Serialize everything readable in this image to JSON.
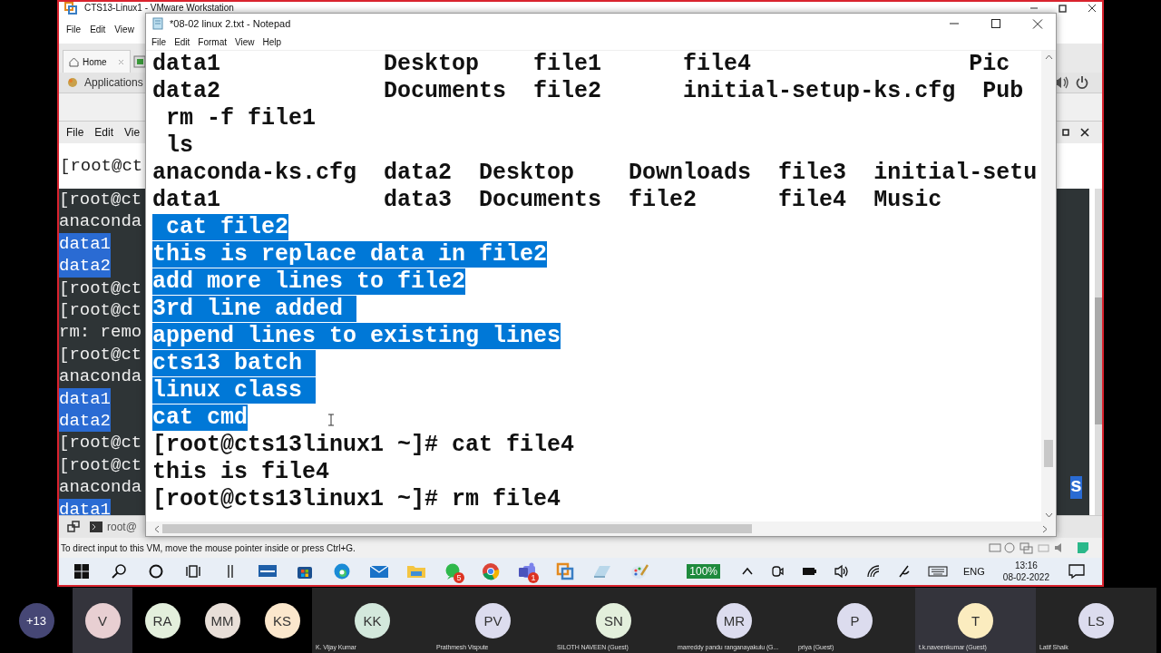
{
  "vmware": {
    "title": "CTS13-Linux1 - VMware Workstation",
    "menu": [
      "File",
      "Edit",
      "View"
    ],
    "tabs": [
      {
        "label": "Home",
        "selected": false
      }
    ],
    "gnome_menu": "Applications",
    "guest_menu": [
      "File",
      "Edit",
      "Vie"
    ],
    "prompt_line": "[root@ct",
    "terminal_lines": [
      {
        "text": "[root@ct",
        "selected": false
      },
      {
        "text": "anaconda",
        "selected": false
      },
      {
        "text": "data1",
        "selected": true
      },
      {
        "text": "data2",
        "selected": true
      },
      {
        "text": "[root@ct",
        "selected": false
      },
      {
        "text": "[root@ct",
        "selected": false
      },
      {
        "text": "rm: remo",
        "selected": false
      },
      {
        "text": "[root@ct",
        "selected": false
      },
      {
        "text": "anaconda",
        "selected": false
      },
      {
        "text": "data1",
        "selected": true
      },
      {
        "text": "data2",
        "selected": true
      },
      {
        "text": "[root@ct",
        "selected": false
      },
      {
        "text": "[root@ct",
        "selected": false
      },
      {
        "text": "anaconda",
        "selected": false,
        "right": {
          "text": "s",
          "selected": true
        }
      },
      {
        "text": "data1",
        "selected": true
      }
    ],
    "bottom_tab": "root@",
    "status": "To direct input to this VM, move the mouse pointer inside or press Ctrl+G."
  },
  "notepad": {
    "title": "*08-02 linux 2.txt - Notepad",
    "menu": [
      "File",
      "Edit",
      "Format",
      "View",
      "Help"
    ],
    "lines": [
      {
        "text": "data1            Desktop    file1      file4                Pic",
        "selected": false
      },
      {
        "text": "data2            Documents  file2      initial-setup-ks.cfg  Pub",
        "selected": false
      },
      {
        "text": " rm -f file1",
        "selected": false
      },
      {
        "text": " ls",
        "selected": false
      },
      {
        "text": "anaconda-ks.cfg  data2  Desktop    Downloads  file3  initial-setu",
        "selected": false
      },
      {
        "text": "data1            data3  Documents  file2      file4  Music",
        "selected": false
      },
      {
        "text": " cat file2",
        "selected": true
      },
      {
        "text": "this is replace data in file2",
        "selected": true
      },
      {
        "text": "add more lines to file2",
        "selected": true
      },
      {
        "text": "3rd line added ",
        "selected": true
      },
      {
        "text": "append lines to existing lines",
        "selected": true
      },
      {
        "text": "cts13 batch ",
        "selected": true
      },
      {
        "text": "linux class ",
        "selected": true
      },
      {
        "text": "cat cmd",
        "selected": true
      },
      {
        "text": "[root@cts13linux1 ~]# cat file4",
        "selected": false
      },
      {
        "text": "this is file4",
        "selected": false
      },
      {
        "text": "[root@cts13linux1 ~]# rm file4",
        "selected": false
      }
    ]
  },
  "taskbar": {
    "items": [
      {
        "kind": "start"
      },
      {
        "kind": "search"
      },
      {
        "kind": "cortana"
      },
      {
        "kind": "taskview"
      },
      {
        "kind": "bars"
      },
      {
        "kind": "monitor"
      },
      {
        "kind": "store"
      },
      {
        "kind": "edge"
      },
      {
        "kind": "mail"
      },
      {
        "kind": "folder"
      },
      {
        "kind": "chat",
        "badge": "5"
      },
      {
        "kind": "chrome"
      },
      {
        "kind": "teams",
        "badge": "1"
      },
      {
        "kind": "vm"
      },
      {
        "kind": "notes"
      },
      {
        "kind": "paint"
      }
    ],
    "zoom": "100%",
    "language": "ENG",
    "time": "13:16",
    "date": "08-02-2022"
  },
  "participants": {
    "overflow": "+13",
    "people": [
      {
        "initials": "V",
        "color": "#e8cfd2",
        "active": true
      },
      {
        "initials": "RA",
        "color": "#e3efdc",
        "active": false
      },
      {
        "initials": "MM",
        "color": "#e8dfd8",
        "active": false
      },
      {
        "initials": "KS",
        "color": "#fbe7cc",
        "active": false
      },
      {
        "initials": "KK",
        "name": "K. Vijay Kumar",
        "color": "#d3e8dc",
        "active": false
      },
      {
        "initials": "PV",
        "name": "Prathmesh Vispute",
        "color": "#dcdcee",
        "active": false
      },
      {
        "initials": "SN",
        "name": "SILOTH NAVEEN (Guest)",
        "color": "#e3efdc",
        "active": false
      },
      {
        "initials": "MR",
        "name": "marreddy pandu ranganayakulu (G...",
        "color": "#dcdcee",
        "active": false
      },
      {
        "initials": "P",
        "name": "priya (Guest)",
        "color": "#dcdcee",
        "active": false
      },
      {
        "initials": "T",
        "name": "t.k.naveenkumar (Guest)",
        "color": "#fbecbf",
        "active": true
      },
      {
        "initials": "LS",
        "name": "Latif Shaik",
        "color": "#dcdcee",
        "active": false
      }
    ]
  }
}
